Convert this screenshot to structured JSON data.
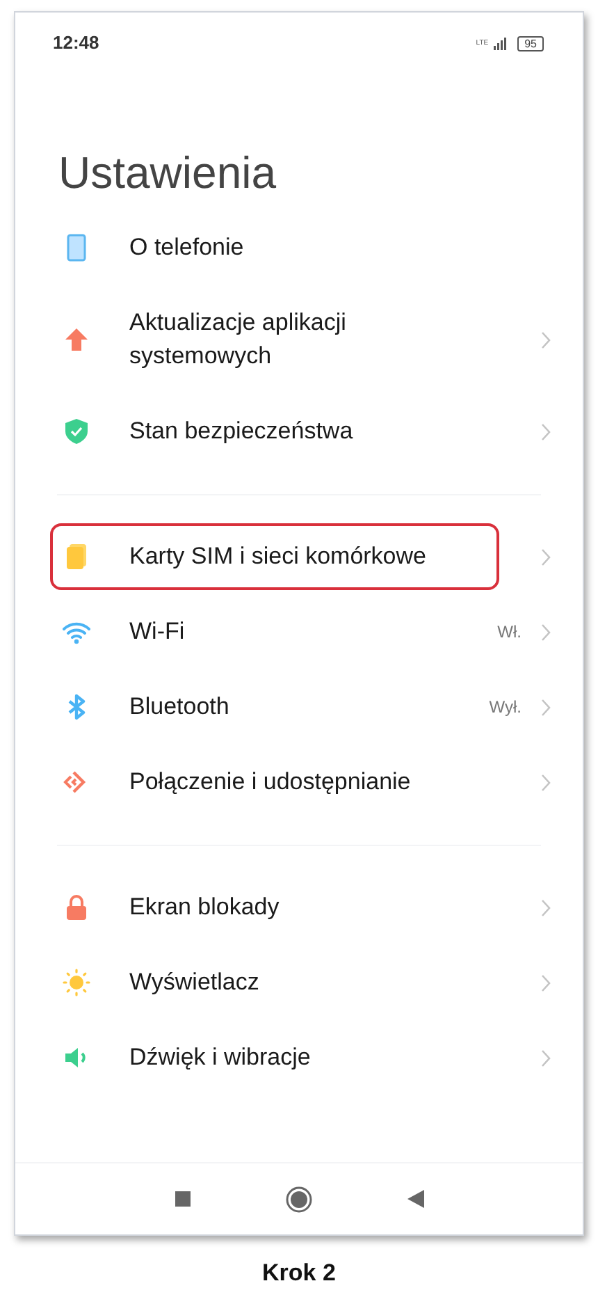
{
  "status_bar": {
    "time": "12:48",
    "network": "LTE",
    "battery": "95"
  },
  "title": "Ustawienia",
  "groups": [
    {
      "items": [
        {
          "kind": "phone",
          "label": "O telefonie",
          "highlighted": false,
          "chevron": false
        },
        {
          "kind": "update",
          "label": "Aktualizacje aplikacji systemowych",
          "highlighted": false,
          "chevron": true
        },
        {
          "kind": "security",
          "label": "Stan bezpieczeństwa",
          "highlighted": false,
          "chevron": true
        }
      ]
    },
    {
      "items": [
        {
          "kind": "sim",
          "label": "Karty SIM i sieci komórkowe",
          "highlighted": true,
          "chevron": true
        },
        {
          "kind": "wifi",
          "label": "Wi-Fi",
          "value": "Wł.",
          "highlighted": false,
          "chevron": true
        },
        {
          "kind": "bluetooth",
          "label": "Bluetooth",
          "value": "Wył.",
          "highlighted": false,
          "chevron": true
        },
        {
          "kind": "connection",
          "label": "Połączenie i udostępnianie",
          "highlighted": false,
          "chevron": true
        }
      ]
    },
    {
      "items": [
        {
          "kind": "lock",
          "label": "Ekran blokady",
          "highlighted": false,
          "chevron": true
        },
        {
          "kind": "display",
          "label": "Wyświetlacz",
          "highlighted": false,
          "chevron": true
        },
        {
          "kind": "sound",
          "label": "Dźwięk i wibracje",
          "highlighted": false,
          "chevron": true
        }
      ]
    }
  ],
  "caption": "Krok 2"
}
